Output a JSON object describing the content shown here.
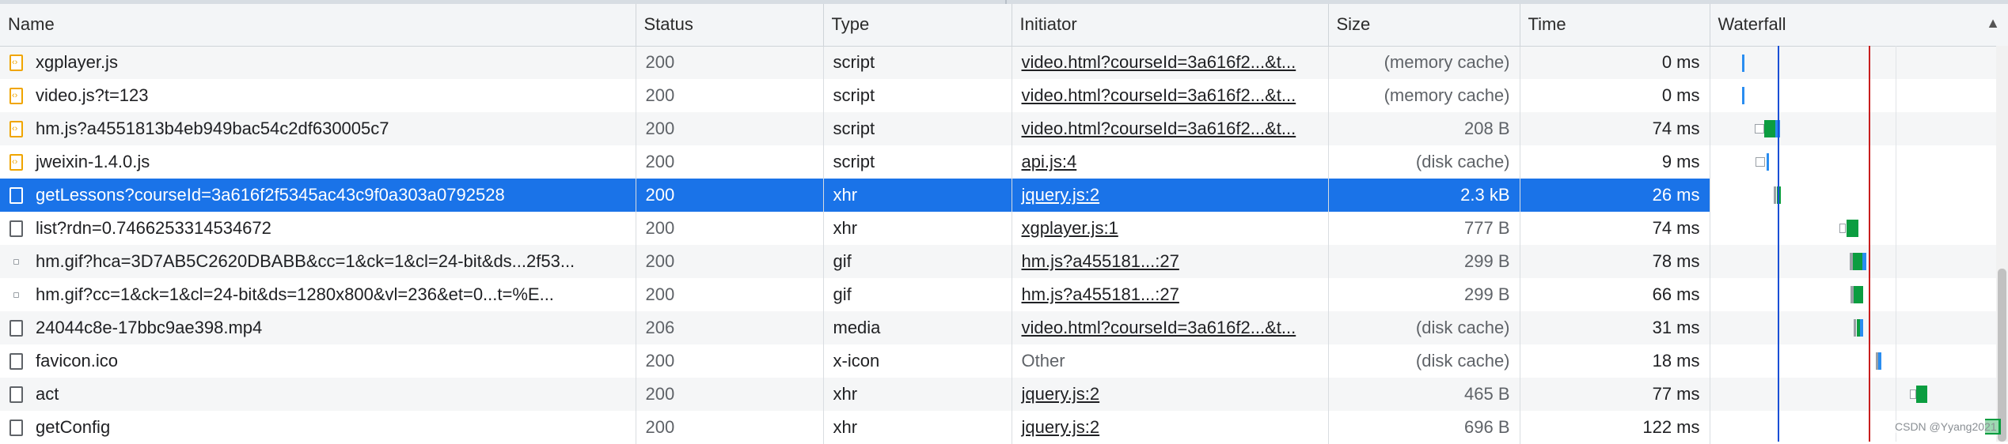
{
  "columns": {
    "name": "Name",
    "status": "Status",
    "type": "Type",
    "initiator": "Initiator",
    "size": "Size",
    "time": "Time",
    "waterfall": "Waterfall"
  },
  "rows": [
    {
      "name": "xgplayer.js",
      "status": "200",
      "type": "script",
      "initiator": "video.html?courseId=3a616f2...&t...",
      "size": "(memory cache)",
      "time": "0 ms",
      "icon": "script-file-icon"
    },
    {
      "name": "video.js?t=123",
      "status": "200",
      "type": "script",
      "initiator": "video.html?courseId=3a616f2...&t...",
      "size": "(memory cache)",
      "time": "0 ms",
      "icon": "script-file-icon"
    },
    {
      "name": "hm.js?a4551813b4eb949bac54c2df630005c7",
      "status": "200",
      "type": "script",
      "initiator": "video.html?courseId=3a616f2...&t...",
      "size": "208 B",
      "time": "74 ms",
      "icon": "script-file-icon"
    },
    {
      "name": "jweixin-1.4.0.js",
      "status": "200",
      "type": "script",
      "initiator": "api.js:4",
      "size": "(disk cache)",
      "time": "9 ms",
      "icon": "script-file-icon"
    },
    {
      "name": "getLessons?courseId=3a616f2f5345ac43c9f0a303a0792528",
      "status": "200",
      "type": "xhr",
      "initiator": "jquery.js:2",
      "size": "2.3 kB",
      "time": "26 ms",
      "icon": "document-icon"
    },
    {
      "name": "list?rdn=0.7466253314534672",
      "status": "200",
      "type": "xhr",
      "initiator": "xgplayer.js:1",
      "size": "777 B",
      "time": "74 ms",
      "icon": "document-icon"
    },
    {
      "name": "hm.gif?hca=3D7AB5C2620DBABB&cc=1&ck=1&cl=24-bit&ds...2f53...",
      "status": "200",
      "type": "gif",
      "initiator": "hm.js?a455181...:27",
      "size": "299 B",
      "time": "78 ms",
      "icon": "image-icon"
    },
    {
      "name": "hm.gif?cc=1&ck=1&cl=24-bit&ds=1280x800&vl=236&et=0...t=%E...",
      "status": "200",
      "type": "gif",
      "initiator": "hm.js?a455181...:27",
      "size": "299 B",
      "time": "66 ms",
      "icon": "image-icon"
    },
    {
      "name": "24044c8e-17bbc9ae398.mp4",
      "status": "206",
      "type": "media",
      "initiator": "video.html?courseId=3a616f2...&t...",
      "size": "(disk cache)",
      "time": "31 ms",
      "icon": "media-icon"
    },
    {
      "name": "favicon.ico",
      "status": "200",
      "type": "x-icon",
      "initiator": "Other",
      "size": "(disk cache)",
      "time": "18 ms",
      "icon": "document-icon"
    },
    {
      "name": "act",
      "status": "200",
      "type": "xhr",
      "initiator": "jquery.js:2",
      "size": "465 B",
      "time": "77 ms",
      "icon": "document-icon"
    },
    {
      "name": "getConfig",
      "status": "200",
      "type": "xhr",
      "initiator": "jquery.js:2",
      "size": "696 B",
      "time": "122 ms",
      "icon": "document-icon"
    }
  ],
  "selected_row": 4,
  "watermark": "CSDN @Yyang2021",
  "colors": {
    "selected": "#1a73e8",
    "waterfall_green": "#0b9d40",
    "waterfall_blue": "#2a8df0",
    "dom_content_loaded_line": "#1a4fd6",
    "load_line": "#c81e1e",
    "script_icon": "#f0a500"
  }
}
